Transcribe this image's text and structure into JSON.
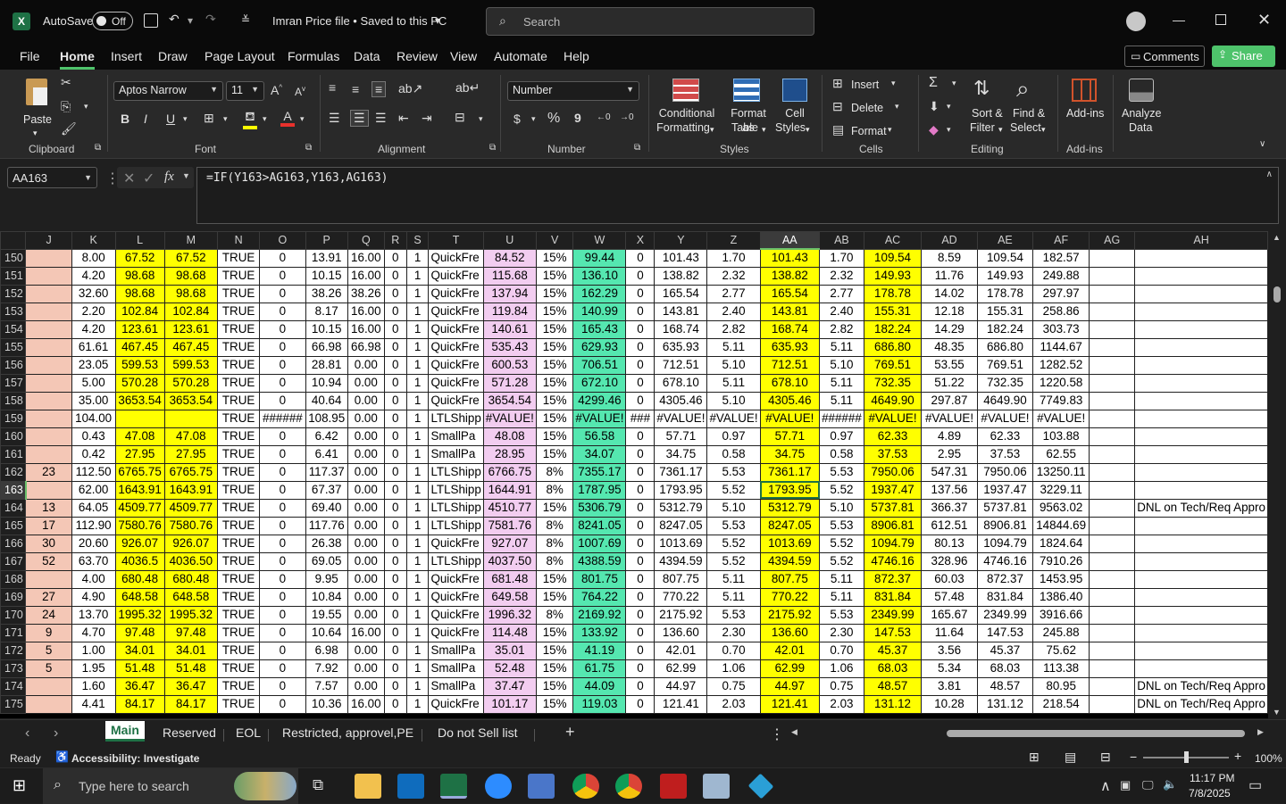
{
  "title": {
    "autosave": "AutoSave",
    "autosave_state": "Off",
    "filename": "Imran Price file • Saved to this PC",
    "search_placeholder": "Search"
  },
  "menu": [
    "File",
    "Home",
    "Insert",
    "Draw",
    "Page Layout",
    "Formulas",
    "Data",
    "Review",
    "View",
    "Automate",
    "Help"
  ],
  "actions": {
    "comments": "Comments",
    "share": "Share"
  },
  "ribbon": {
    "clipboard": {
      "label": "Clipboard",
      "paste": "Paste"
    },
    "font": {
      "label": "Font",
      "name": "Aptos Narrow",
      "size": "11",
      "bold": "B",
      "italic": "I",
      "underline": "U"
    },
    "alignment": {
      "label": "Alignment"
    },
    "number": {
      "label": "Number",
      "format": "Number",
      "currency": "$",
      "percent": "%",
      "comma": "9"
    },
    "styles": {
      "label": "Styles",
      "conditional": "Conditional",
      "conditional2": "Formatting",
      "format_as": "Format as",
      "format_as2": "Table",
      "cell_styles": "Cell",
      "cell_styles2": "Styles"
    },
    "cells": {
      "label": "Cells",
      "insert": "Insert",
      "delete": "Delete",
      "format": "Format"
    },
    "editing": {
      "label": "Editing",
      "sort": "Sort &",
      "sort2": "Filter",
      "find": "Find &",
      "find2": "Select"
    },
    "addins": {
      "label": "Add-ins",
      "addins": "Add-ins",
      "analyze": "Analyze",
      "analyze2": "Data"
    }
  },
  "formula_bar": {
    "name_box": "AA163",
    "fx": "fx",
    "formula": "=IF(Y163>AG163,Y163,AG163)"
  },
  "columns": [
    "J",
    "K",
    "L",
    "M",
    "N",
    "O",
    "P",
    "Q",
    "R",
    "S",
    "T",
    "U",
    "V",
    "W",
    "X",
    "Y",
    "Z",
    "AA",
    "AB",
    "AC",
    "AD",
    "AE",
    "AF",
    "AG",
    "AH"
  ],
  "rows": [
    {
      "n": "150",
      "c": [
        "",
        "8.00",
        "67.52",
        "67.52",
        "TRUE",
        "0",
        "13.91",
        "16.00",
        "0",
        "1",
        "QuickFre",
        "84.52",
        "15%",
        "99.44",
        "0",
        "101.43",
        "1.70",
        "101.43",
        "1.70",
        "109.54",
        "8.59",
        "109.54",
        "182.57",
        "",
        ""
      ]
    },
    {
      "n": "151",
      "c": [
        "",
        "4.20",
        "98.68",
        "98.68",
        "TRUE",
        "0",
        "10.15",
        "16.00",
        "0",
        "1",
        "QuickFre",
        "115.68",
        "15%",
        "136.10",
        "0",
        "138.82",
        "2.32",
        "138.82",
        "2.32",
        "149.93",
        "11.76",
        "149.93",
        "249.88",
        "",
        ""
      ]
    },
    {
      "n": "152",
      "c": [
        "",
        "32.60",
        "98.68",
        "98.68",
        "TRUE",
        "0",
        "38.26",
        "38.26",
        "0",
        "1",
        "QuickFre",
        "137.94",
        "15%",
        "162.29",
        "0",
        "165.54",
        "2.77",
        "165.54",
        "2.77",
        "178.78",
        "14.02",
        "178.78",
        "297.97",
        "",
        ""
      ]
    },
    {
      "n": "153",
      "c": [
        "",
        "2.20",
        "102.84",
        "102.84",
        "TRUE",
        "0",
        "8.17",
        "16.00",
        "0",
        "1",
        "QuickFre",
        "119.84",
        "15%",
        "140.99",
        "0",
        "143.81",
        "2.40",
        "143.81",
        "2.40",
        "155.31",
        "12.18",
        "155.31",
        "258.86",
        "",
        ""
      ]
    },
    {
      "n": "154",
      "c": [
        "",
        "4.20",
        "123.61",
        "123.61",
        "TRUE",
        "0",
        "10.15",
        "16.00",
        "0",
        "1",
        "QuickFre",
        "140.61",
        "15%",
        "165.43",
        "0",
        "168.74",
        "2.82",
        "168.74",
        "2.82",
        "182.24",
        "14.29",
        "182.24",
        "303.73",
        "",
        ""
      ]
    },
    {
      "n": "155",
      "c": [
        "",
        "61.61",
        "467.45",
        "467.45",
        "TRUE",
        "0",
        "66.98",
        "66.98",
        "0",
        "1",
        "QuickFre",
        "535.43",
        "15%",
        "629.93",
        "0",
        "635.93",
        "5.11",
        "635.93",
        "5.11",
        "686.80",
        "48.35",
        "686.80",
        "1144.67",
        "",
        ""
      ]
    },
    {
      "n": "156",
      "c": [
        "",
        "23.05",
        "599.53",
        "599.53",
        "TRUE",
        "0",
        "28.81",
        "0.00",
        "0",
        "1",
        "QuickFre",
        "600.53",
        "15%",
        "706.51",
        "0",
        "712.51",
        "5.10",
        "712.51",
        "5.10",
        "769.51",
        "53.55",
        "769.51",
        "1282.52",
        "",
        ""
      ]
    },
    {
      "n": "157",
      "c": [
        "",
        "5.00",
        "570.28",
        "570.28",
        "TRUE",
        "0",
        "10.94",
        "0.00",
        "0",
        "1",
        "QuickFre",
        "571.28",
        "15%",
        "672.10",
        "0",
        "678.10",
        "5.11",
        "678.10",
        "5.11",
        "732.35",
        "51.22",
        "732.35",
        "1220.58",
        "",
        ""
      ]
    },
    {
      "n": "158",
      "c": [
        "",
        "35.00",
        "3653.54",
        "3653.54",
        "TRUE",
        "0",
        "40.64",
        "0.00",
        "0",
        "1",
        "QuickFre",
        "3654.54",
        "15%",
        "4299.46",
        "0",
        "4305.46",
        "5.10",
        "4305.46",
        "5.11",
        "4649.90",
        "297.87",
        "4649.90",
        "7749.83",
        "",
        ""
      ]
    },
    {
      "n": "159",
      "c": [
        "",
        "104.00",
        "",
        "",
        "TRUE",
        "######",
        "108.95",
        "0.00",
        "0",
        "1",
        "LTLShipp",
        "#VALUE!",
        "15%",
        "#VALUE!",
        "###",
        "#VALUE!",
        "#VALUE!",
        "#VALUE!",
        "######",
        "#VALUE!",
        "#VALUE!",
        "#VALUE!",
        "#VALUE!",
        "",
        ""
      ]
    },
    {
      "n": "160",
      "c": [
        "",
        "0.43",
        "47.08",
        "47.08",
        "TRUE",
        "0",
        "6.42",
        "0.00",
        "0",
        "1",
        "SmallPa",
        "48.08",
        "15%",
        "56.58",
        "0",
        "57.71",
        "0.97",
        "57.71",
        "0.97",
        "62.33",
        "4.89",
        "62.33",
        "103.88",
        "",
        ""
      ]
    },
    {
      "n": "161",
      "c": [
        "",
        "0.42",
        "27.95",
        "27.95",
        "TRUE",
        "0",
        "6.41",
        "0.00",
        "0",
        "1",
        "SmallPa",
        "28.95",
        "15%",
        "34.07",
        "0",
        "34.75",
        "0.58",
        "34.75",
        "0.58",
        "37.53",
        "2.95",
        "37.53",
        "62.55",
        "",
        ""
      ]
    },
    {
      "n": "162",
      "c": [
        "23",
        "112.50",
        "6765.75",
        "6765.75",
        "TRUE",
        "0",
        "117.37",
        "0.00",
        "0",
        "1",
        "LTLShipp",
        "6766.75",
        "8%",
        "7355.17",
        "0",
        "7361.17",
        "5.53",
        "7361.17",
        "5.53",
        "7950.06",
        "547.31",
        "7950.06",
        "13250.11",
        "",
        ""
      ]
    },
    {
      "n": "163",
      "c": [
        "",
        "62.00",
        "1643.91",
        "1643.91",
        "TRUE",
        "0",
        "67.37",
        "0.00",
        "0",
        "1",
        "LTLShipp",
        "1644.91",
        "8%",
        "1787.95",
        "0",
        "1793.95",
        "5.52",
        "1793.95",
        "5.52",
        "1937.47",
        "137.56",
        "1937.47",
        "3229.11",
        "",
        ""
      ]
    },
    {
      "n": "164",
      "c": [
        "13",
        "64.05",
        "4509.77",
        "4509.77",
        "TRUE",
        "0",
        "69.40",
        "0.00",
        "0",
        "1",
        "LTLShipp",
        "4510.77",
        "15%",
        "5306.79",
        "0",
        "5312.79",
        "5.10",
        "5312.79",
        "5.10",
        "5737.81",
        "366.37",
        "5737.81",
        "9563.02",
        "",
        "DNL on Tech/Req Appro"
      ]
    },
    {
      "n": "165",
      "c": [
        "17",
        "112.90",
        "7580.76",
        "7580.76",
        "TRUE",
        "0",
        "117.76",
        "0.00",
        "0",
        "1",
        "LTLShipp",
        "7581.76",
        "8%",
        "8241.05",
        "0",
        "8247.05",
        "5.53",
        "8247.05",
        "5.53",
        "8906.81",
        "612.51",
        "8906.81",
        "14844.69",
        "",
        ""
      ]
    },
    {
      "n": "166",
      "c": [
        "30",
        "20.60",
        "926.07",
        "926.07",
        "TRUE",
        "0",
        "26.38",
        "0.00",
        "0",
        "1",
        "QuickFre",
        "927.07",
        "8%",
        "1007.69",
        "0",
        "1013.69",
        "5.52",
        "1013.69",
        "5.52",
        "1094.79",
        "80.13",
        "1094.79",
        "1824.64",
        "",
        ""
      ]
    },
    {
      "n": "167",
      "c": [
        "52",
        "63.70",
        "4036.5",
        "4036.50",
        "TRUE",
        "0",
        "69.05",
        "0.00",
        "0",
        "1",
        "LTLShipp",
        "4037.50",
        "8%",
        "4388.59",
        "0",
        "4394.59",
        "5.52",
        "4394.59",
        "5.52",
        "4746.16",
        "328.96",
        "4746.16",
        "7910.26",
        "",
        ""
      ]
    },
    {
      "n": "168",
      "c": [
        "",
        "4.00",
        "680.48",
        "680.48",
        "TRUE",
        "0",
        "9.95",
        "0.00",
        "0",
        "1",
        "QuickFre",
        "681.48",
        "15%",
        "801.75",
        "0",
        "807.75",
        "5.11",
        "807.75",
        "5.11",
        "872.37",
        "60.03",
        "872.37",
        "1453.95",
        "",
        ""
      ]
    },
    {
      "n": "169",
      "c": [
        "27",
        "4.90",
        "648.58",
        "648.58",
        "TRUE",
        "0",
        "10.84",
        "0.00",
        "0",
        "1",
        "QuickFre",
        "649.58",
        "15%",
        "764.22",
        "0",
        "770.22",
        "5.11",
        "770.22",
        "5.11",
        "831.84",
        "57.48",
        "831.84",
        "1386.40",
        "",
        ""
      ]
    },
    {
      "n": "170",
      "c": [
        "24",
        "13.70",
        "1995.32",
        "1995.32",
        "TRUE",
        "0",
        "19.55",
        "0.00",
        "0",
        "1",
        "QuickFre",
        "1996.32",
        "8%",
        "2169.92",
        "0",
        "2175.92",
        "5.53",
        "2175.92",
        "5.53",
        "2349.99",
        "165.67",
        "2349.99",
        "3916.66",
        "",
        ""
      ]
    },
    {
      "n": "171",
      "c": [
        "9",
        "4.70",
        "97.48",
        "97.48",
        "TRUE",
        "0",
        "10.64",
        "16.00",
        "0",
        "1",
        "QuickFre",
        "114.48",
        "15%",
        "133.92",
        "0",
        "136.60",
        "2.30",
        "136.60",
        "2.30",
        "147.53",
        "11.64",
        "147.53",
        "245.88",
        "",
        ""
      ]
    },
    {
      "n": "172",
      "c": [
        "5",
        "1.00",
        "34.01",
        "34.01",
        "TRUE",
        "0",
        "6.98",
        "0.00",
        "0",
        "1",
        "SmallPa",
        "35.01",
        "15%",
        "41.19",
        "0",
        "42.01",
        "0.70",
        "42.01",
        "0.70",
        "45.37",
        "3.56",
        "45.37",
        "75.62",
        "",
        ""
      ]
    },
    {
      "n": "173",
      "c": [
        "5",
        "1.95",
        "51.48",
        "51.48",
        "TRUE",
        "0",
        "7.92",
        "0.00",
        "0",
        "1",
        "SmallPa",
        "52.48",
        "15%",
        "61.75",
        "0",
        "62.99",
        "1.06",
        "62.99",
        "1.06",
        "68.03",
        "5.34",
        "68.03",
        "113.38",
        "",
        ""
      ]
    },
    {
      "n": "174",
      "c": [
        "",
        "1.60",
        "36.47",
        "36.47",
        "TRUE",
        "0",
        "7.57",
        "0.00",
        "0",
        "1",
        "SmallPa",
        "37.47",
        "15%",
        "44.09",
        "0",
        "44.97",
        "0.75",
        "44.97",
        "0.75",
        "48.57",
        "3.81",
        "48.57",
        "80.95",
        "",
        "DNL on Tech/Req Appro"
      ]
    },
    {
      "n": "175",
      "c": [
        "",
        "4.41",
        "84.17",
        "84.17",
        "TRUE",
        "0",
        "10.36",
        "16.00",
        "0",
        "1",
        "QuickFre",
        "101.17",
        "15%",
        "119.03",
        "0",
        "121.41",
        "2.03",
        "121.41",
        "2.03",
        "131.12",
        "10.28",
        "131.12",
        "218.54",
        "",
        "DNL on Tech/Req Appro"
      ]
    }
  ],
  "selected_cell": {
    "column": "AA",
    "row": "163"
  },
  "sheets": [
    "Main",
    "Reserved",
    "EOL",
    "Restricted, approvel,PE",
    "Do not Sell list"
  ],
  "active_sheet": "Main",
  "status": {
    "ready": "Ready",
    "accessibility": "Accessibility: Investigate",
    "zoom": "100%"
  },
  "taskbar": {
    "search_placeholder": "Type here to search",
    "time": "11:17 PM",
    "date": "7/8/2025"
  },
  "colors": {
    "salmon": "#f4c7b6",
    "yellow": "#ffff00",
    "pink": "#f2cdf0",
    "green": "#55e7b0",
    "excel_green": "#1e7145",
    "share": "#4ec36b"
  }
}
